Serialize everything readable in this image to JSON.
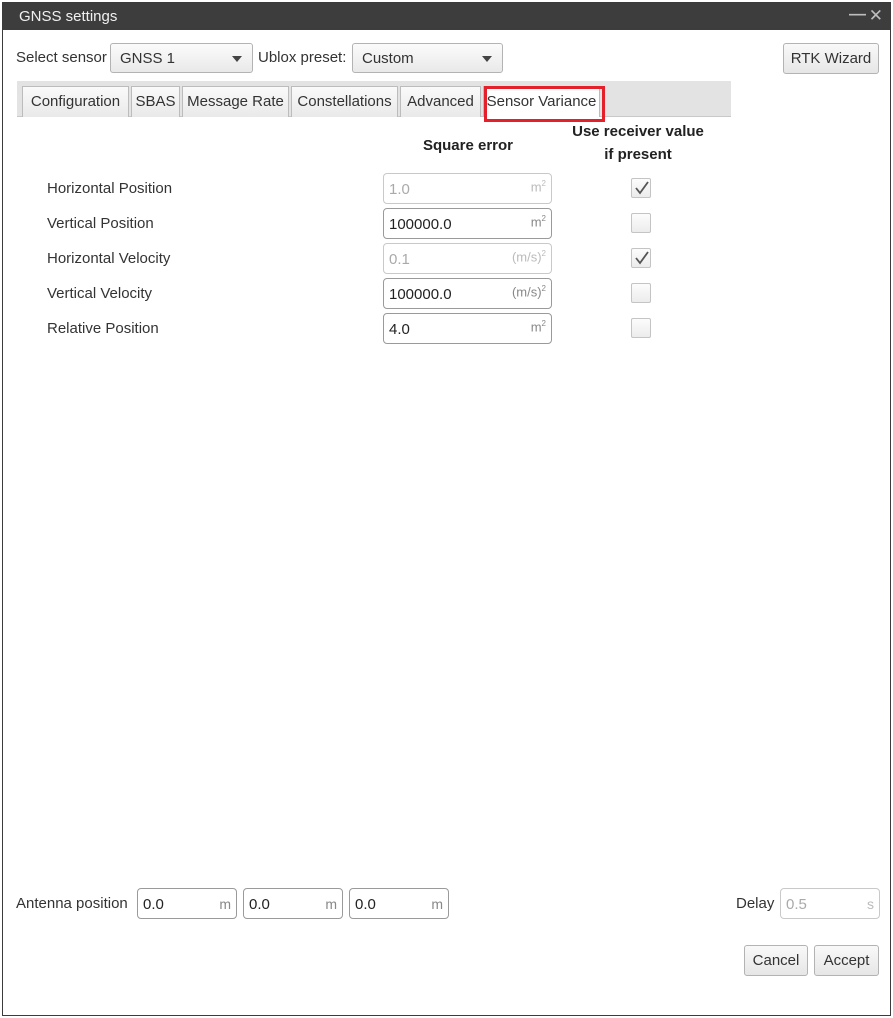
{
  "window": {
    "title": "GNSS settings"
  },
  "top": {
    "select_sensor_label": "Select sensor",
    "select_sensor_value": "GNSS 1",
    "ublox_preset_label": "Ublox preset:",
    "ublox_preset_value": "Custom",
    "rtk_wizard_label": "RTK Wizard"
  },
  "tabs": [
    {
      "label": "Configuration"
    },
    {
      "label": "SBAS"
    },
    {
      "label": "Message Rate"
    },
    {
      "label": "Constellations"
    },
    {
      "label": "Advanced"
    },
    {
      "label": "Sensor Variance"
    }
  ],
  "active_tab": "Sensor Variance",
  "variance": {
    "square_error_header": "Square error",
    "use_receiver_header_line1": "Use receiver value",
    "use_receiver_header_line2": "if  present",
    "rows": [
      {
        "label": "Horizontal Position",
        "value": "1.0",
        "unit": "m",
        "unit_exp": "2",
        "enabled": false,
        "use_receiver": true
      },
      {
        "label": "Vertical Position",
        "value": "100000.0",
        "unit": "m",
        "unit_exp": "2",
        "enabled": true,
        "use_receiver": false
      },
      {
        "label": "Horizontal Velocity",
        "value": "0.1",
        "unit": "(m/s)",
        "unit_exp": "2",
        "enabled": false,
        "use_receiver": true
      },
      {
        "label": "Vertical Velocity",
        "value": "100000.0",
        "unit": "(m/s)",
        "unit_exp": "2",
        "enabled": true,
        "use_receiver": false
      },
      {
        "label": "Relative Position",
        "value": "4.0",
        "unit": "m",
        "unit_exp": "2",
        "enabled": true,
        "use_receiver": false
      }
    ]
  },
  "antenna": {
    "label": "Antenna position",
    "x": {
      "value": "0.0",
      "unit": "m"
    },
    "y": {
      "value": "0.0",
      "unit": "m"
    },
    "z": {
      "value": "0.0",
      "unit": "m"
    }
  },
  "delay": {
    "label": "Delay",
    "value": "0.5",
    "unit": "s"
  },
  "footer": {
    "cancel_label": "Cancel",
    "accept_label": "Accept"
  },
  "colors": {
    "highlight_border": "#e4202a",
    "titlebar_bg": "#3d3d3d"
  },
  "icons": {
    "close": "close-icon",
    "minimize": "minimize-icon",
    "dropdown": "chevron-down-icon",
    "check": "checkmark-icon"
  }
}
